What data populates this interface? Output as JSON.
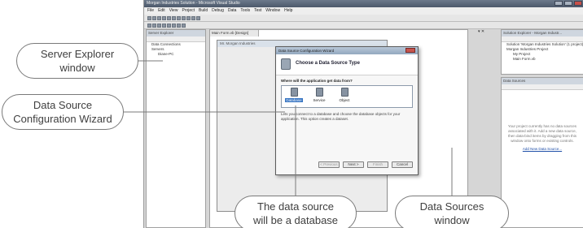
{
  "window": {
    "title": "Morgan Industries Solution - Microsoft Visual Studio"
  },
  "menu": [
    "File",
    "Edit",
    "View",
    "Project",
    "Build",
    "Debug",
    "Data",
    "Tools",
    "Test",
    "Window",
    "Help"
  ],
  "server_explorer": {
    "title": "Server Explorer",
    "items": [
      "Data Connections",
      "Servers",
      "Diane-PC"
    ]
  },
  "designer": {
    "tab_label": "Main Form.vb [Design]",
    "form_title": "Mr. Morgan Industries"
  },
  "wizard": {
    "title": "Data Source Configuration Wizard",
    "heading": "Choose a Data Source Type",
    "question": "Where will the application get data from?",
    "types": [
      {
        "label": "Database",
        "selected": true
      },
      {
        "label": "Service",
        "selected": false
      },
      {
        "label": "Object",
        "selected": false
      }
    ],
    "description": "Lets you connect to a database and choose the database objects for your application. This option creates a dataset.",
    "buttons": {
      "previous": "< Previous",
      "next": "Next >",
      "finish": "Finish",
      "cancel": "Cancel"
    }
  },
  "solution_explorer": {
    "title": "Solution Explorer - Morgan Industr...",
    "items": [
      "Solution 'Morgan Industries Solution' (1 project)",
      "Morgan Industries Project",
      "My Project",
      "Main Form.vb"
    ]
  },
  "data_sources": {
    "title": "Data Sources",
    "empty_text": "Your project currently has no data sources associated with it. Add a new data source, then data-bind items by dragging from this window onto forms or existing controls.",
    "link": "Add New Data Source..."
  },
  "callouts": {
    "server_explorer": [
      "Server Explorer",
      "window"
    ],
    "wizard": [
      "Data Source",
      "Configuration Wizard"
    ],
    "database": [
      "The data source",
      "will be a database"
    ],
    "data_sources": [
      "Data Sources",
      "window"
    ]
  },
  "colors": {
    "selection": "#3473c2",
    "link": "#1f4fa8",
    "callout_border": "#7a7a7a"
  }
}
